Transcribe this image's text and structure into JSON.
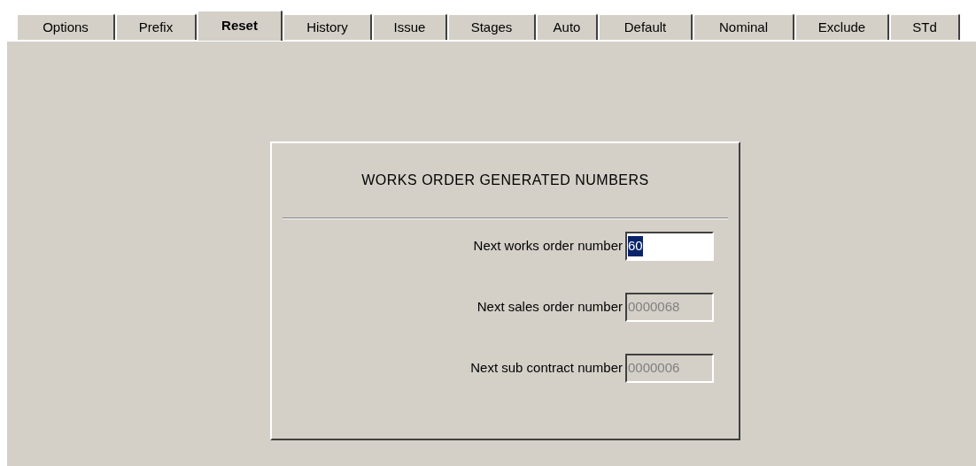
{
  "tabs": [
    {
      "label": "Options",
      "selected": false
    },
    {
      "label": "Prefix",
      "selected": false
    },
    {
      "label": "Reset",
      "selected": true
    },
    {
      "label": "History",
      "selected": false
    },
    {
      "label": "Issue",
      "selected": false
    },
    {
      "label": "Stages",
      "selected": false
    },
    {
      "label": "Auto",
      "selected": false
    },
    {
      "label": "Default",
      "selected": false
    },
    {
      "label": "Nominal",
      "selected": false
    },
    {
      "label": "Exclude",
      "selected": false
    },
    {
      "label": "STd",
      "selected": false
    }
  ],
  "group": {
    "title": "WORKS ORDER GENERATED NUMBERS",
    "fields": [
      {
        "label": "Next works order number",
        "value": "60",
        "disabled": false,
        "text_selected": true
      },
      {
        "label": "Next sales order number",
        "value": "0000068",
        "disabled": true,
        "text_selected": false
      },
      {
        "label": "Next sub contract number",
        "value": "0000006",
        "disabled": true,
        "text_selected": false
      }
    ]
  }
}
